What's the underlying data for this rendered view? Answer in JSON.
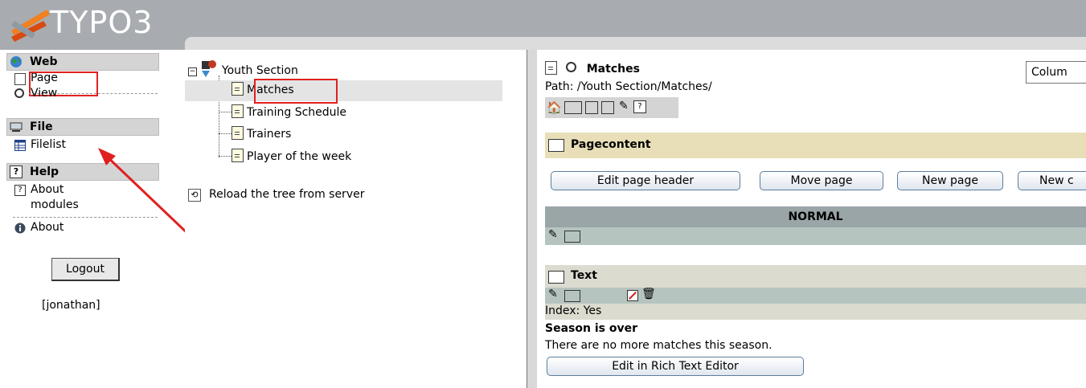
{
  "header": {
    "logo_text": "TYPO3"
  },
  "menu": {
    "groups": [
      {
        "label": "Web",
        "icon": "globe-icon",
        "items": [
          {
            "label": "Page",
            "icon": "page-icon"
          },
          {
            "label": "View",
            "icon": "magnifier-icon"
          }
        ]
      },
      {
        "label": "File",
        "icon": "drive-icon",
        "items": [
          {
            "label": "Filelist",
            "icon": "table-icon"
          }
        ]
      },
      {
        "label": "Help",
        "icon": "help-icon",
        "items": [
          {
            "label": "About",
            "label2": "modules",
            "icon": "help-icon"
          },
          {
            "label": "About",
            "icon": "info-icon"
          }
        ]
      }
    ],
    "logout_label": "Logout",
    "username": "[jonathan]"
  },
  "tree": {
    "root": "Youth Section",
    "children": [
      "Matches",
      "Training Schedule",
      "Trainers",
      "Player of the week"
    ],
    "reload_label": "Reload the tree from server"
  },
  "content": {
    "page_title": "Matches",
    "path": "Path: /Youth Section/Matches/",
    "column_select": "Colum",
    "section_header": "Pagecontent",
    "buttons": [
      "Edit page header",
      "Move page",
      "New page",
      "New c"
    ],
    "column_header": "NORMAL",
    "element_type": "Text",
    "index_line": "Index: Yes",
    "element_heading": "Season is over",
    "element_body": "There are no more matches this season.",
    "rte_button": "Edit in Rich Text Editor"
  },
  "colors": {
    "header_bg": "#a8acb0",
    "section_bg": "#e8dfb8",
    "column_bg": "#9aa5a8",
    "row_bg": "#b6c4c0",
    "highlight": "#e02020"
  }
}
